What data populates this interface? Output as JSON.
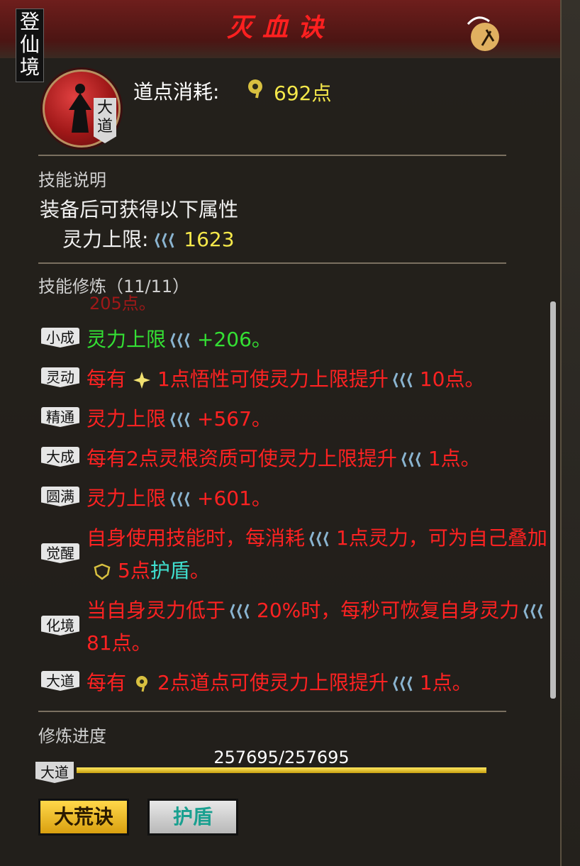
{
  "skill": {
    "title": "灭血诀",
    "realm": "登仙境",
    "avatar_tag": "大道",
    "cost_label": "道点消耗:",
    "cost_value": "692点"
  },
  "description": {
    "heading": "技能说明",
    "line1": "装备后可获得以下属性",
    "stat_label": "灵力上限:",
    "stat_value": "1623"
  },
  "training": {
    "heading": "技能修炼（11/11）",
    "partial_text": "205点。",
    "rows": [
      {
        "badge": "小成",
        "segments": [
          {
            "t": "灵力上限",
            "c": "green"
          },
          {
            "icon": "mana"
          },
          {
            "t": "+206。",
            "c": "green"
          }
        ]
      },
      {
        "badge": "灵动",
        "segments": [
          {
            "t": "每有",
            "c": "red"
          },
          {
            "icon": "star"
          },
          {
            "t": "1点悟性可使灵力上限提升",
            "c": "red"
          },
          {
            "icon": "mana"
          },
          {
            "t": "10点。",
            "c": "red"
          }
        ]
      },
      {
        "badge": "精通",
        "segments": [
          {
            "t": "灵力上限",
            "c": "red"
          },
          {
            "icon": "mana"
          },
          {
            "t": "+567。",
            "c": "red"
          }
        ]
      },
      {
        "badge": "大成",
        "segments": [
          {
            "t": "每有2点灵根资质可使灵力上限提升",
            "c": "red"
          },
          {
            "icon": "mana"
          },
          {
            "t": "1点。",
            "c": "red"
          }
        ]
      },
      {
        "badge": "圆满",
        "segments": [
          {
            "t": "灵力上限",
            "c": "red"
          },
          {
            "icon": "mana"
          },
          {
            "t": "+601。",
            "c": "red"
          }
        ]
      },
      {
        "badge": "觉醒",
        "segments": [
          {
            "t": "自身使用技能时，每消耗",
            "c": "red"
          },
          {
            "icon": "mana"
          },
          {
            "t": "1点灵力，可为自己叠加",
            "c": "red"
          },
          {
            "icon": "shield"
          },
          {
            "t": "5点",
            "c": "red"
          },
          {
            "t": "护盾",
            "c": "cyan"
          },
          {
            "t": "。",
            "c": "red"
          }
        ]
      },
      {
        "badge": "化境",
        "segments": [
          {
            "t": "当自身灵力低于",
            "c": "red"
          },
          {
            "icon": "mana"
          },
          {
            "t": "20%时，每秒可恢复自身灵力",
            "c": "red"
          },
          {
            "icon": "mana"
          },
          {
            "t": "81点。",
            "c": "red"
          }
        ]
      },
      {
        "badge": "大道",
        "segments": [
          {
            "t": "每有",
            "c": "red"
          },
          {
            "icon": "dao"
          },
          {
            "t": "2点道点可使灵力上限提升",
            "c": "red"
          },
          {
            "icon": "mana"
          },
          {
            "t": "1点。",
            "c": "red"
          }
        ]
      }
    ]
  },
  "progress": {
    "heading": "修炼进度",
    "badge": "大道",
    "text": "257695/257695",
    "fraction": 1.0
  },
  "buttons": {
    "primary": "大荒诀",
    "secondary": "护盾"
  },
  "colors": {
    "title_red": "#ff2020",
    "value_yellow": "#f5e84a",
    "effect_red": "#ff2222",
    "effect_green": "#34e034",
    "shield_cyan": "#40e0d0"
  }
}
